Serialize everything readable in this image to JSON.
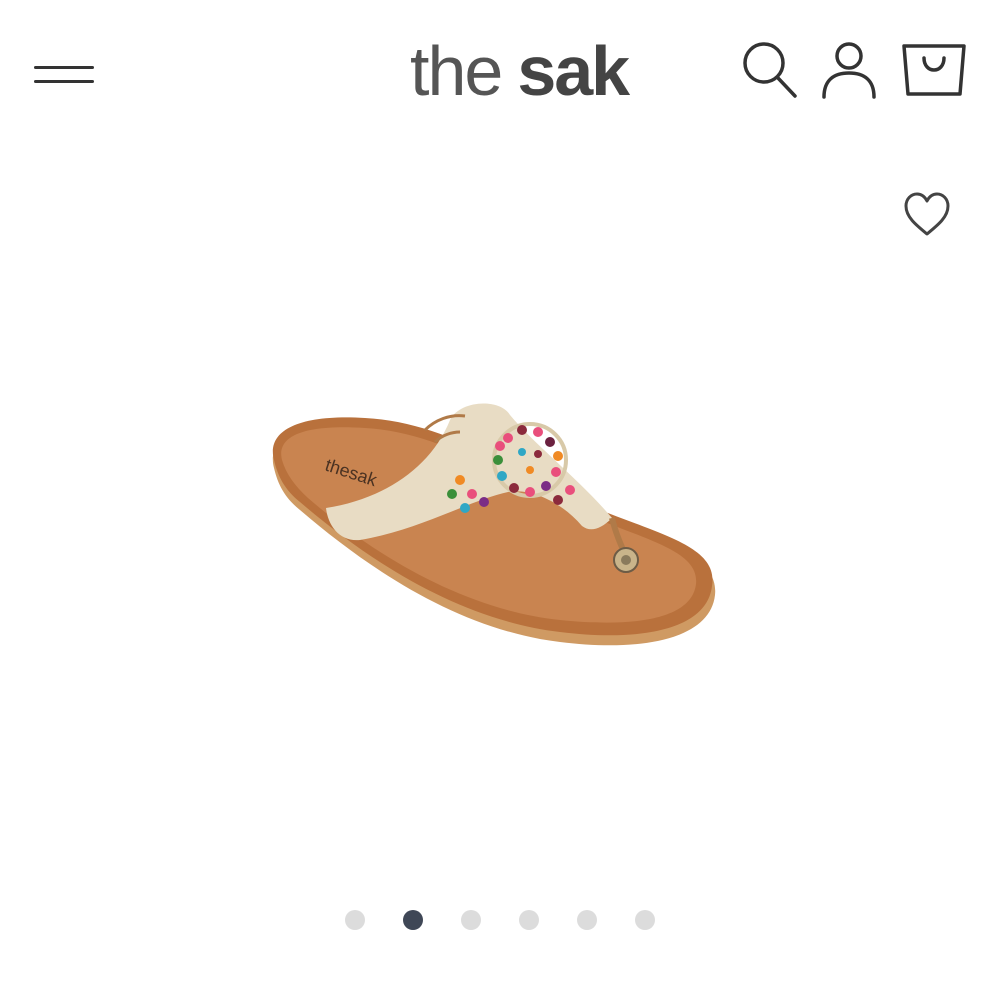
{
  "header": {
    "menu_icon": "hamburger-menu-icon",
    "logo": {
      "part1": "the",
      "part2": "sak"
    },
    "search_icon": "search-icon",
    "account_icon": "user-icon",
    "cart_icon": "shopping-bag-icon"
  },
  "product": {
    "wishlist_icon": "heart-icon",
    "image_brand_text": "thesak",
    "carousel": {
      "total": 6,
      "active_index": 1
    }
  },
  "colors": {
    "accent_dark": "#3f4756",
    "dot_inactive": "#dcdcdc",
    "icon_stroke": "#333333"
  }
}
